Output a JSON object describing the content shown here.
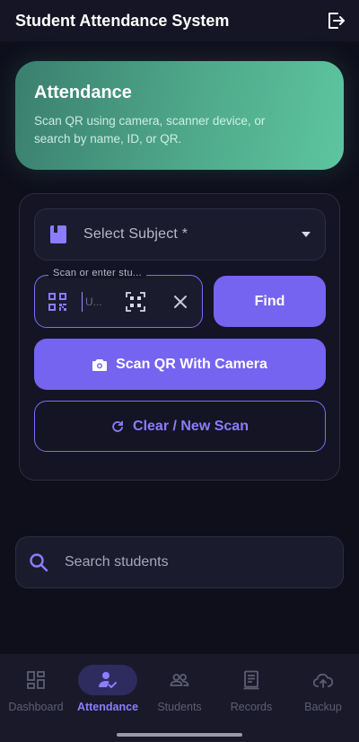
{
  "appbar": {
    "title": "Student Attendance System",
    "logout_icon": "logout-icon"
  },
  "hero": {
    "title": "Attendance",
    "description": "Scan QR using camera, scanner device, or search by name, ID, or QR."
  },
  "form": {
    "subject_select": {
      "label": "Select Subject *",
      "icon": "book-icon"
    },
    "scan_field": {
      "legend": "Scan or enter stu...",
      "placeholder": "U..."
    },
    "find_label": "Find",
    "camera_label": "Scan QR With Camera",
    "clear_label": "Clear / New Scan"
  },
  "search": {
    "placeholder": "Search students"
  },
  "nav": {
    "items": [
      {
        "label": "Dashboard",
        "icon": "dashboard-icon"
      },
      {
        "label": "Attendance",
        "icon": "attendance-icon",
        "active": true
      },
      {
        "label": "Students",
        "icon": "students-icon"
      },
      {
        "label": "Records",
        "icon": "records-icon"
      },
      {
        "label": "Backup",
        "icon": "backup-icon"
      }
    ]
  },
  "colors": {
    "accent": "#7564f0",
    "accent_text": "#8b7dff",
    "background": "#0f0f1c",
    "hero_gradient_start": "#3b7f6f",
    "hero_gradient_end": "#5dc5a0",
    "inactive_nav": "#5e5e73"
  }
}
